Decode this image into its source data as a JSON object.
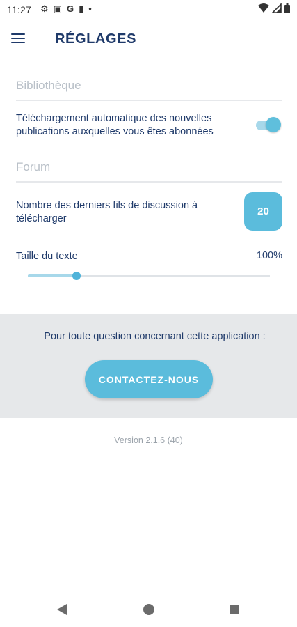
{
  "status_bar": {
    "time": "11:27",
    "notification_icons": [
      "gear-icon",
      "image-icon",
      "google-g-icon",
      "sim-card-icon",
      "dot-icon"
    ],
    "notification_glyphs": [
      "⚙",
      "▣",
      "G",
      "▮",
      "•"
    ],
    "right_icons": [
      "wifi-icon",
      "signal-icon",
      "battery-icon"
    ]
  },
  "app_bar": {
    "menu_icon": "hamburger-menu-icon",
    "title": "RÉGLAGES"
  },
  "library_section": {
    "header": "Bibliothèque",
    "auto_download": {
      "label": "Téléchargement automatique des nouvelles publications auxquelles vous êtes abonnées",
      "enabled": true
    }
  },
  "forum_section": {
    "header": "Forum",
    "thread_count": {
      "label": "Nombre des derniers fils de discussion à télécharger",
      "value": "20"
    }
  },
  "text_size": {
    "label": "Taille du texte",
    "value_text": "100%",
    "slider_fraction": 0.2
  },
  "contact": {
    "question": "Pour toute question concernant cette application :",
    "button_label": "CONTACTEZ-NOUS"
  },
  "version": "Version 2.1.6 (40)",
  "colors": {
    "primary_text": "#1f3a6a",
    "accent": "#5bbcdc",
    "accent_light": "#a7d8ea",
    "muted": "#b9c0c8",
    "contact_bg": "#e6e8ea"
  }
}
